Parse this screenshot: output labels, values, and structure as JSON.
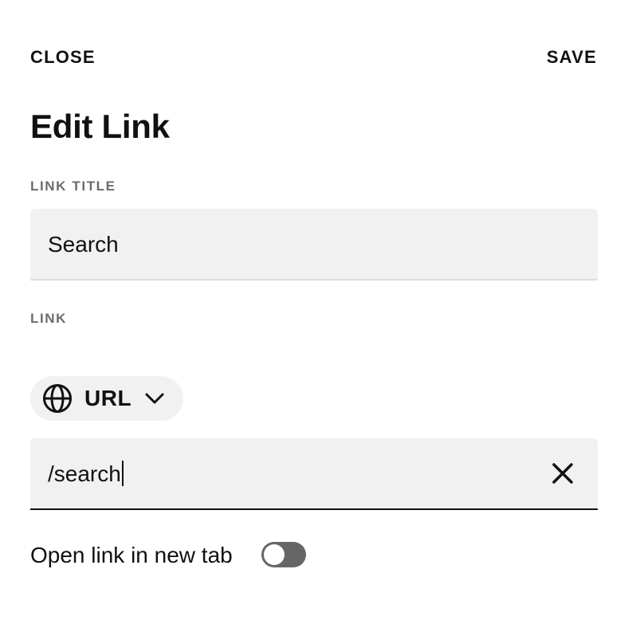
{
  "header": {
    "close_label": "CLOSE",
    "save_label": "SAVE",
    "title": "Edit Link"
  },
  "link_title": {
    "label": "LINK TITLE",
    "value": "Search"
  },
  "link": {
    "label": "LINK",
    "type_selector": {
      "icon": "globe-icon",
      "selected": "URL",
      "chevron_icon": "chevron-down-icon"
    },
    "value": "/search",
    "clear_icon": "close-icon"
  },
  "new_tab": {
    "label": "Open link in new tab",
    "enabled": false
  },
  "colors": {
    "field_bg": "#f1f1f1",
    "label_gray": "#6b6b6b",
    "toggle_off": "#666666",
    "text": "#111111"
  }
}
